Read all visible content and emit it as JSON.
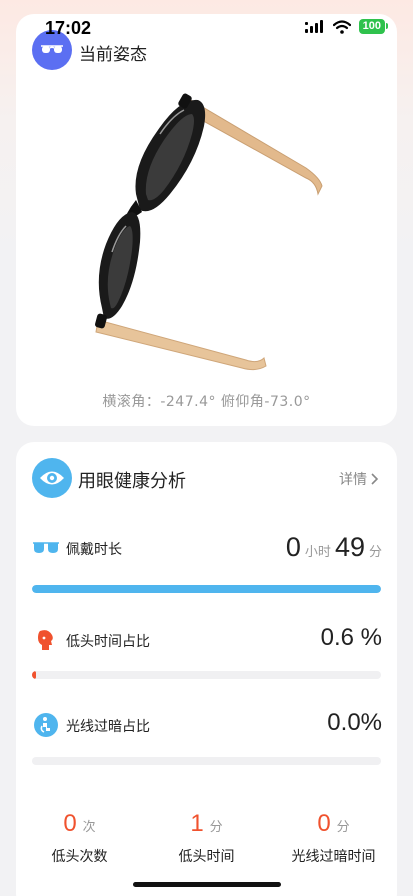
{
  "status_bar": {
    "time": "17:02",
    "battery": "100",
    "battery_color": "#2fc24d"
  },
  "posture": {
    "title": "当前姿态",
    "icon": "glasses-icon",
    "roll_label": "横滚角",
    "roll_value": "-247.4°",
    "pitch_label": "俯仰角",
    "pitch_value": "-73.0°",
    "angles_text": "横滚角：-247.4° 俯仰角-73.0°"
  },
  "health": {
    "title": "用眼健康分析",
    "icon": "eye-icon",
    "detail_label": "详情",
    "accent": "#4fb5ee",
    "metrics": [
      {
        "label": "佩戴时长",
        "icon": "sunglasses-icon",
        "hours": "0",
        "hours_unit": "小时",
        "minutes": "49",
        "minutes_unit": "分",
        "progress": 1.0,
        "color": "#4fb5ee"
      },
      {
        "label": "低头时间占比",
        "icon": "head-down-icon",
        "value": "0.6 %",
        "progress": 0.006,
        "color": "#f0522e"
      },
      {
        "label": "光线过暗占比",
        "icon": "dim-light-icon",
        "value": "0.0%",
        "progress": 0.0,
        "color": "#4fb5ee"
      }
    ],
    "stats": [
      {
        "value": "0",
        "unit": "次",
        "label": "低头次数"
      },
      {
        "value": "1",
        "unit": "分",
        "label": "低头时间"
      },
      {
        "value": "0",
        "unit": "分",
        "label": "光线过暗时间"
      }
    ]
  }
}
